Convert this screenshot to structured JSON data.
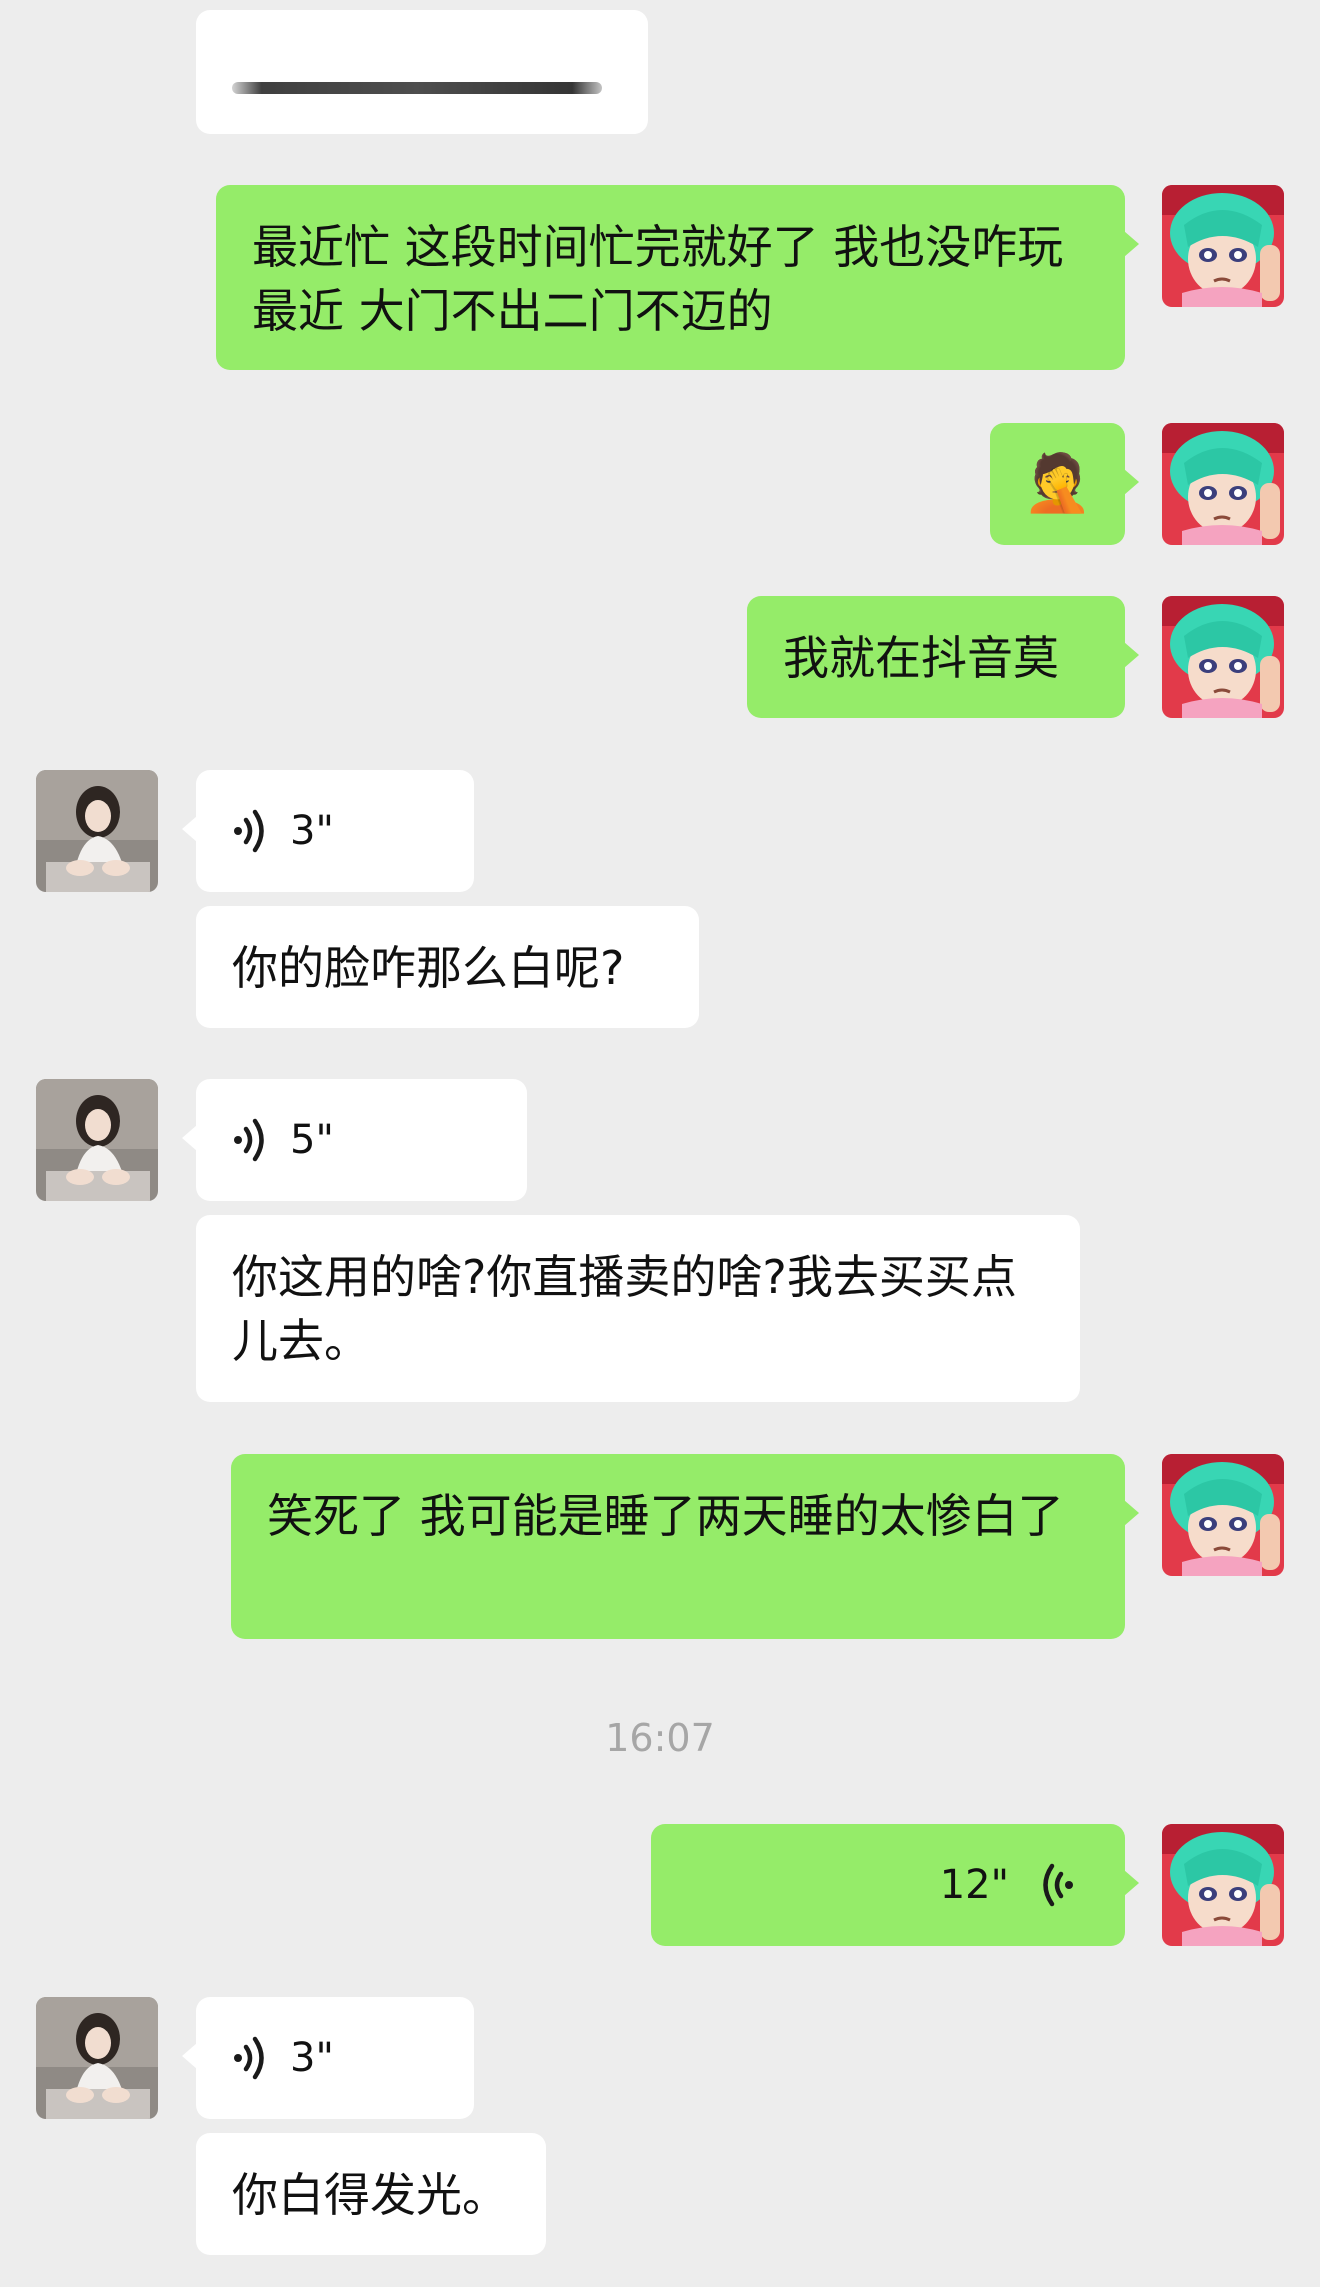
{
  "chat": {
    "messages": [
      {
        "text": "最近忙 这段时间忙完就好了 我也没咋玩最近 大门不出二门不迈的"
      },
      {
        "emoji": "🤦"
      },
      {
        "text": "我就在抖音莫"
      },
      {
        "voice_duration": "3\""
      },
      {
        "text": "你的脸咋那么白呢?"
      },
      {
        "voice_duration": "5\""
      },
      {
        "text": "你这用的啥?你直播卖的啥?我去买买点儿去。"
      },
      {
        "text": "笑死了 我可能是睡了两天睡的太惨白了"
      },
      {
        "voice_duration": "12\""
      },
      {
        "voice_duration": "3\""
      },
      {
        "text": "你白得发光。"
      }
    ],
    "timestamp": "16:07"
  },
  "colors": {
    "background": "#ededed",
    "outgoing_bubble": "#95ec69",
    "incoming_bubble": "#ffffff",
    "timestamp_text": "#a6a6a6"
  },
  "icons": {
    "voice_in": "voice-wave-icon",
    "voice_out": "voice-wave-icon-mirrored",
    "self_avatar": "anime-girl-teal-hair-avatar",
    "contact_avatar": "woman-photo-avatar"
  }
}
